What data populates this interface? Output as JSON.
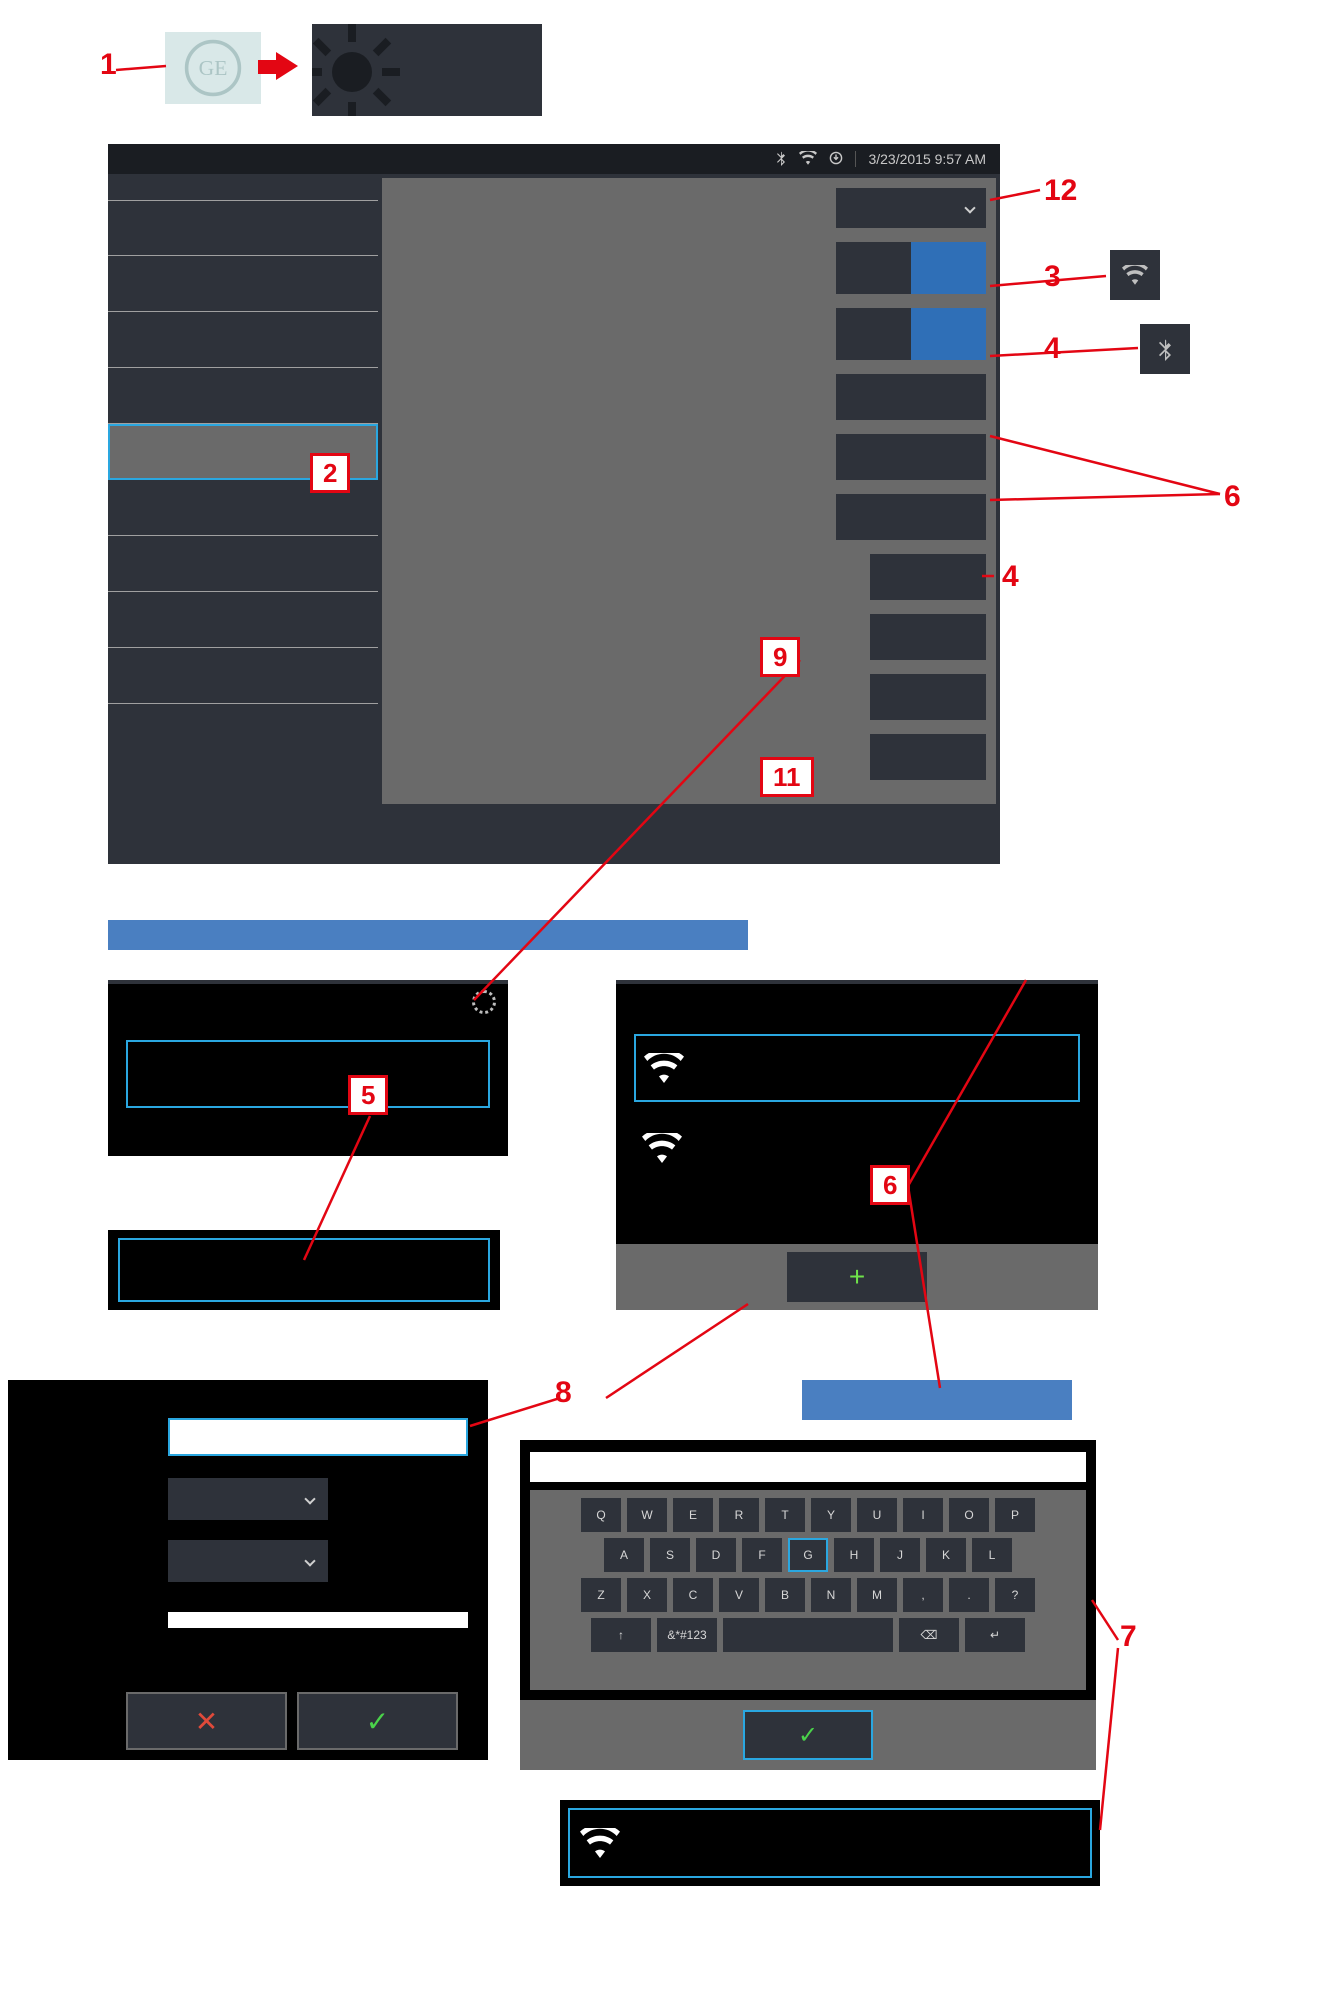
{
  "annotations": {
    "n1": "1",
    "n2": "2",
    "n3": "3",
    "n4": "4",
    "n5": "5",
    "n6": "6",
    "n7": "7",
    "n8": "8",
    "n9": "9",
    "n11": "11",
    "n12": "12"
  },
  "statusbar": {
    "datetime": "3/23/2015  9:57 AM"
  },
  "keyboard": {
    "row1": [
      "Q",
      "W",
      "E",
      "R",
      "T",
      "Y",
      "U",
      "I",
      "O",
      "P"
    ],
    "row2": [
      "A",
      "S",
      "D",
      "F",
      "G",
      "H",
      "J",
      "K",
      "L"
    ],
    "row3": [
      "Z",
      "X",
      "C",
      "V",
      "B",
      "N",
      "M",
      ",",
      ".",
      "?"
    ],
    "row4": {
      "shift": "↑",
      "symbols": "&*#123",
      "enter": "↵",
      "back": "⌫"
    }
  },
  "icons": {
    "plus": "+",
    "check": "✓",
    "cross": "✕",
    "bluetooth": "bluetooth-icon",
    "wifi": "wifi-icon",
    "down": "down-arrow-icon"
  }
}
